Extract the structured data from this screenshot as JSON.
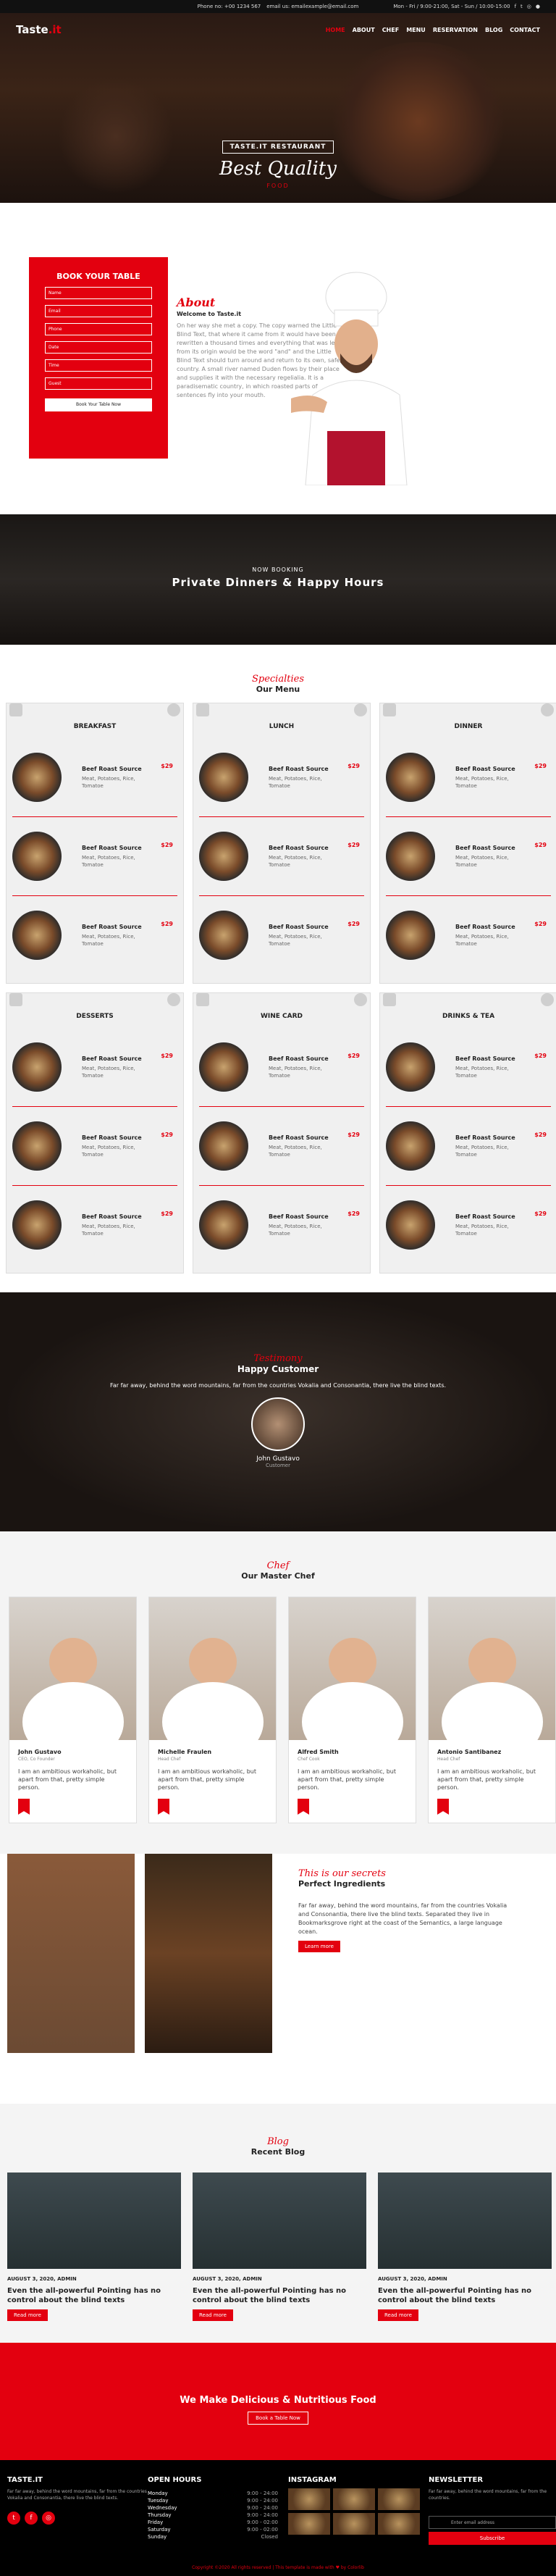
{
  "topbar": {
    "phone": "Phone no: +00 1234 567",
    "email": "email us: emailexample@email.com",
    "hours": "Mon - Fri / 9:00-21:00, Sat - Sun / 10:00-15:00"
  },
  "nav": {
    "logo": "Taste",
    "logo_suffix": ".it",
    "items": [
      "HOME",
      "ABOUT",
      "CHEF",
      "MENU",
      "RESERVATION",
      "BLOG",
      "CONTACT"
    ]
  },
  "hero": {
    "badge": "TASTE.IT RESTAURANT",
    "title": "Best Quality",
    "sub": "FOOD"
  },
  "booking": {
    "title": "BOOK YOUR TABLE",
    "fields": [
      "Name",
      "Email",
      "Phone",
      "Date",
      "Time",
      "Guest"
    ],
    "button": "Book Your Table Now"
  },
  "about": {
    "script": "About",
    "heading": "Welcome to Taste.it",
    "text": "On her way she met a copy. The copy warned the Little Blind Text, that where it came from it would have been rewritten a thousand times and everything that was left from its origin would be the word \"and\" and the Little Blind Text should turn around and return to its own, safe country. A small river named Duden flows by their place and supplies it with the necessary regelialia. It is a paradisematic country, in which roasted parts of sentences fly into your mouth."
  },
  "banner": {
    "small": "NOW BOOKING",
    "big": "Private Dinners & Happy Hours"
  },
  "menu": {
    "script": "Specialties",
    "title": "Our Menu",
    "item_name": "Beef Roast Source",
    "item_desc": "Meat, Potatoes, Rice, Tomatoe",
    "price": "$29",
    "categories": [
      "BREAKFAST",
      "LUNCH",
      "DINNER",
      "DESSERTS",
      "WINE CARD",
      "DRINKS & TEA"
    ]
  },
  "testimonial": {
    "script": "Testimony",
    "title": "Happy Customer",
    "text": "Far far away, behind the word mountains, far from the countries Vokalia and Consonantia, there live the blind texts.",
    "name": "John Gustavo",
    "role": "Customer"
  },
  "chefs": {
    "script": "Chef",
    "title": "Our Master Chef",
    "bio": "I am an ambitious workaholic, but apart from that, pretty simple person.",
    "list": [
      {
        "name": "John Gustavo",
        "role": "CEO, Co Founder"
      },
      {
        "name": "Michelle Fraulen",
        "role": "Head Chef"
      },
      {
        "name": "Alfred Smith",
        "role": "Chef Cook"
      },
      {
        "name": "Antonio Santibanez",
        "role": "Head Chef"
      }
    ]
  },
  "ingredients": {
    "script": "This is our secrets",
    "title": "Perfect Ingredients",
    "text": "Far far away, behind the word mountains, far from the countries Vokalia and Consonantia, there live the blind texts. Separated they live in Bookmarksgrove right at the coast of the Semantics, a large language ocean.",
    "button": "Learn more"
  },
  "blog": {
    "script": "Blog",
    "title": "Recent Blog",
    "meta": "AUGUST 3, 2020, ADMIN",
    "post_title": "Even the all-powerful Pointing has no control about the blind texts",
    "button": "Read more"
  },
  "cta": {
    "title": "We Make Delicious & Nutritious Food",
    "button": "Book a Table Now"
  },
  "footer": {
    "brand": "TASTE.IT",
    "brand_text": "Far far away, behind the word mountains, far from the countries Vokalia and Consonantia, there live the blind texts.",
    "hours_title": "OPEN HOURS",
    "hours": [
      {
        "d": "Monday",
        "t": "9:00 - 24:00"
      },
      {
        "d": "Tuesday",
        "t": "9:00 - 24:00"
      },
      {
        "d": "Wednesday",
        "t": "9:00 - 24:00"
      },
      {
        "d": "Thursday",
        "t": "9:00 - 24:00"
      },
      {
        "d": "Friday",
        "t": "9:00 - 02:00"
      },
      {
        "d": "Saturday",
        "t": "9:00 - 02:00"
      },
      {
        "d": "Sunday",
        "t": "Closed"
      }
    ],
    "instagram_title": "INSTAGRAM",
    "newsletter_title": "NEWSLETTER",
    "newsletter_text": "Far far away, behind the word mountains, far from the countries.",
    "email_placeholder": "Enter email address",
    "subscribe": "Subscribe",
    "copyright": "Copyright ©2020 All rights reserved | This template is made with ♥ by Colorlib"
  },
  "colors": {
    "accent": "#e3000f"
  }
}
